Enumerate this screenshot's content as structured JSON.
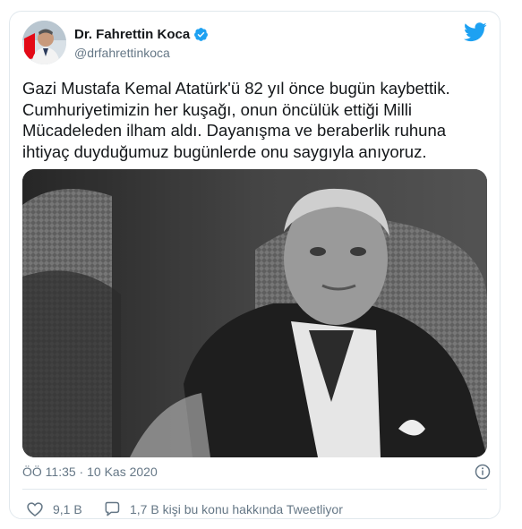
{
  "author": {
    "name": "Dr. Fahrettin Koca",
    "handle": "@drfahrettinkoca",
    "verified": true
  },
  "tweet": {
    "text": "Gazi Mustafa Kemal Atatürk'ü 82 yıl önce bugün kaybettik.\nCumhuriyetimizin her kuşağı, onun öncülük ettiği Milli\nMücadeleden ilham aldı. Dayanışma ve beraberlik ruhuna\nihtiyaç duyduğumuz bugünlerde onu saygıyla anıyoruz.",
    "timestamp": "ÖÖ 11:35 · 10 Kas 2020"
  },
  "actions": {
    "likes": "9,1 B",
    "conversation": "1,7 B kişi bu konu hakkında Tweetliyor"
  },
  "icons": {
    "logo": "twitter-bird-icon",
    "verified": "verified-badge-icon",
    "info": "info-icon",
    "like": "heart-icon",
    "reply": "speech-bubble-icon"
  },
  "colors": {
    "brand": "#1da1f2",
    "text": "#14171a",
    "secondary": "#657786",
    "border": "#e1e8ed"
  }
}
